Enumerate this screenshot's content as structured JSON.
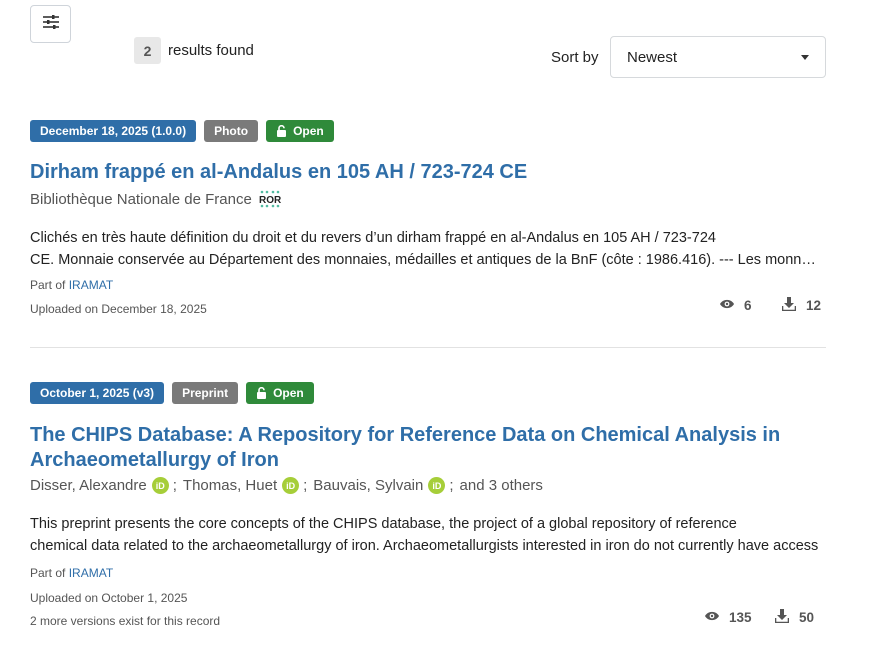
{
  "toolbar": {
    "filter_icon": "sliders-icon"
  },
  "results": {
    "count": "2",
    "label": "results found"
  },
  "sort": {
    "label": "Sort by",
    "selected": "Newest"
  },
  "records": [
    {
      "date_badge": "December 18, 2025 (1.0.0)",
      "type_badge": "Photo",
      "access_badge": "Open",
      "title": "Dirham frappé en al-Andalus en 105 AH / 723-724 CE",
      "affiliation": "Bibliothèque Nationale de France",
      "ror_logo": "ROR",
      "description_line1": "Clichés en très haute définition du droit et du revers d’un dirham frappé en al-Andalus en 105 AH / 723-724",
      "description_line2": "CE. Monnaie conservée au Département des monnaies, médailles et antiques de la BnF (côte : 1986.416). --- Les monnaies frappées",
      "part_of_label": "Part of",
      "community": "IRAMAT",
      "uploaded": "Uploaded on December 18, 2025",
      "views": "6",
      "downloads": "12"
    },
    {
      "date_badge": "October 1, 2025 (v3)",
      "type_badge": "Preprint",
      "access_badge": "Open",
      "title_line1": "The CHIPS Database: A Repository for Reference Data on Chemical Analysis in",
      "title_line2": "Archaeometallurgy of Iron",
      "authors": [
        "Disser, Alexandre",
        "Thomas, Huet",
        "Bauvais, Sylvain"
      ],
      "others": "and 3 others",
      "description_line1": "This preprint presents the core concepts of the CHIPS database, the project of a global repository of reference",
      "description_line2": "chemical data related to the archaeometallurgy of iron.   Archaeometallurgists interested in iron do not currently have access",
      "part_of_label": "Part of",
      "community": "IRAMAT",
      "uploaded": "Uploaded on October 1, 2025",
      "versions": "2 more versions exist for this record",
      "views": "135",
      "downloads": "50"
    }
  ]
}
